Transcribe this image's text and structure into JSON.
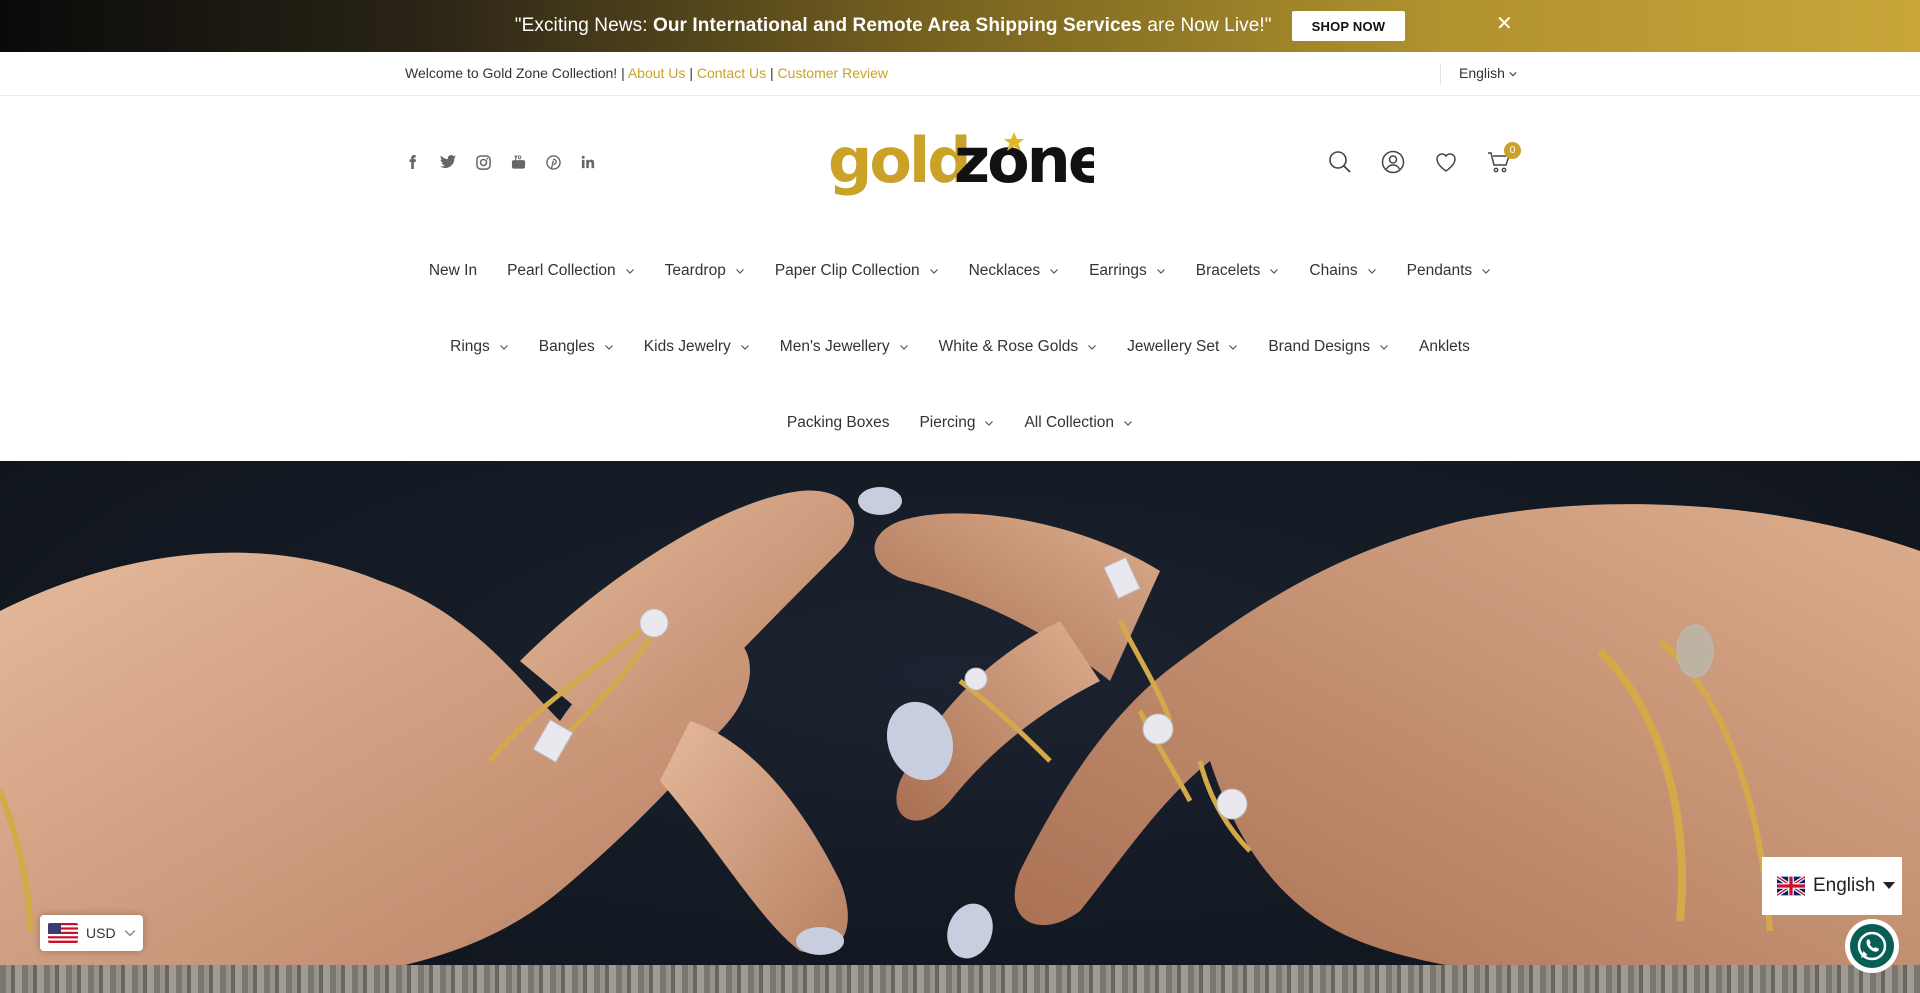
{
  "announcement": {
    "prefix": "\"Exciting News: ",
    "bold": "Our International and Remote Area Shipping Services",
    "suffix": " are Now Live!\"",
    "cta": "SHOP NOW",
    "close": "✕"
  },
  "util": {
    "welcome": "Welcome to Gold Zone Collection! |",
    "about": "About Us",
    "sep1": "|",
    "contact": "Contact Us",
    "sep2": "|",
    "review": "Customer Review",
    "language": "English"
  },
  "header": {
    "logo_text_gold": "gold",
    "logo_text_dark": "zone",
    "social": [
      "facebook-icon",
      "twitter-icon",
      "instagram-icon",
      "youtube-icon",
      "pinterest-icon",
      "linkedin-icon"
    ],
    "icons": [
      "search-icon",
      "account-icon",
      "wishlist-icon",
      "cart-icon"
    ],
    "cart_count": "0"
  },
  "nav": {
    "row1": [
      {
        "label": "New In",
        "dropdown": false
      },
      {
        "label": "Pearl Collection",
        "dropdown": true
      },
      {
        "label": "Teardrop",
        "dropdown": true
      },
      {
        "label": "Paper Clip Collection",
        "dropdown": true
      },
      {
        "label": "Necklaces",
        "dropdown": true
      },
      {
        "label": "Earrings",
        "dropdown": true
      },
      {
        "label": "Bracelets",
        "dropdown": true
      },
      {
        "label": "Chains",
        "dropdown": true
      },
      {
        "label": "Pendants",
        "dropdown": true
      }
    ],
    "row2": [
      {
        "label": "Rings",
        "dropdown": true
      },
      {
        "label": "Bangles",
        "dropdown": true
      },
      {
        "label": "Kids Jewelry",
        "dropdown": true
      },
      {
        "label": "Men's Jewellery",
        "dropdown": true
      },
      {
        "label": "White & Rose Golds",
        "dropdown": true
      },
      {
        "label": "Jewellery Set",
        "dropdown": true
      },
      {
        "label": "Brand Designs",
        "dropdown": true
      },
      {
        "label": "Anklets",
        "dropdown": false
      }
    ],
    "row3": [
      {
        "label": "Packing Boxes",
        "dropdown": false
      },
      {
        "label": "Piercing",
        "dropdown": true
      },
      {
        "label": "All Collection",
        "dropdown": true
      }
    ]
  },
  "currency": {
    "code": "USD"
  },
  "language_switcher": {
    "label": "English"
  },
  "colors": {
    "gold": "#c9a227",
    "dark": "#111111"
  }
}
